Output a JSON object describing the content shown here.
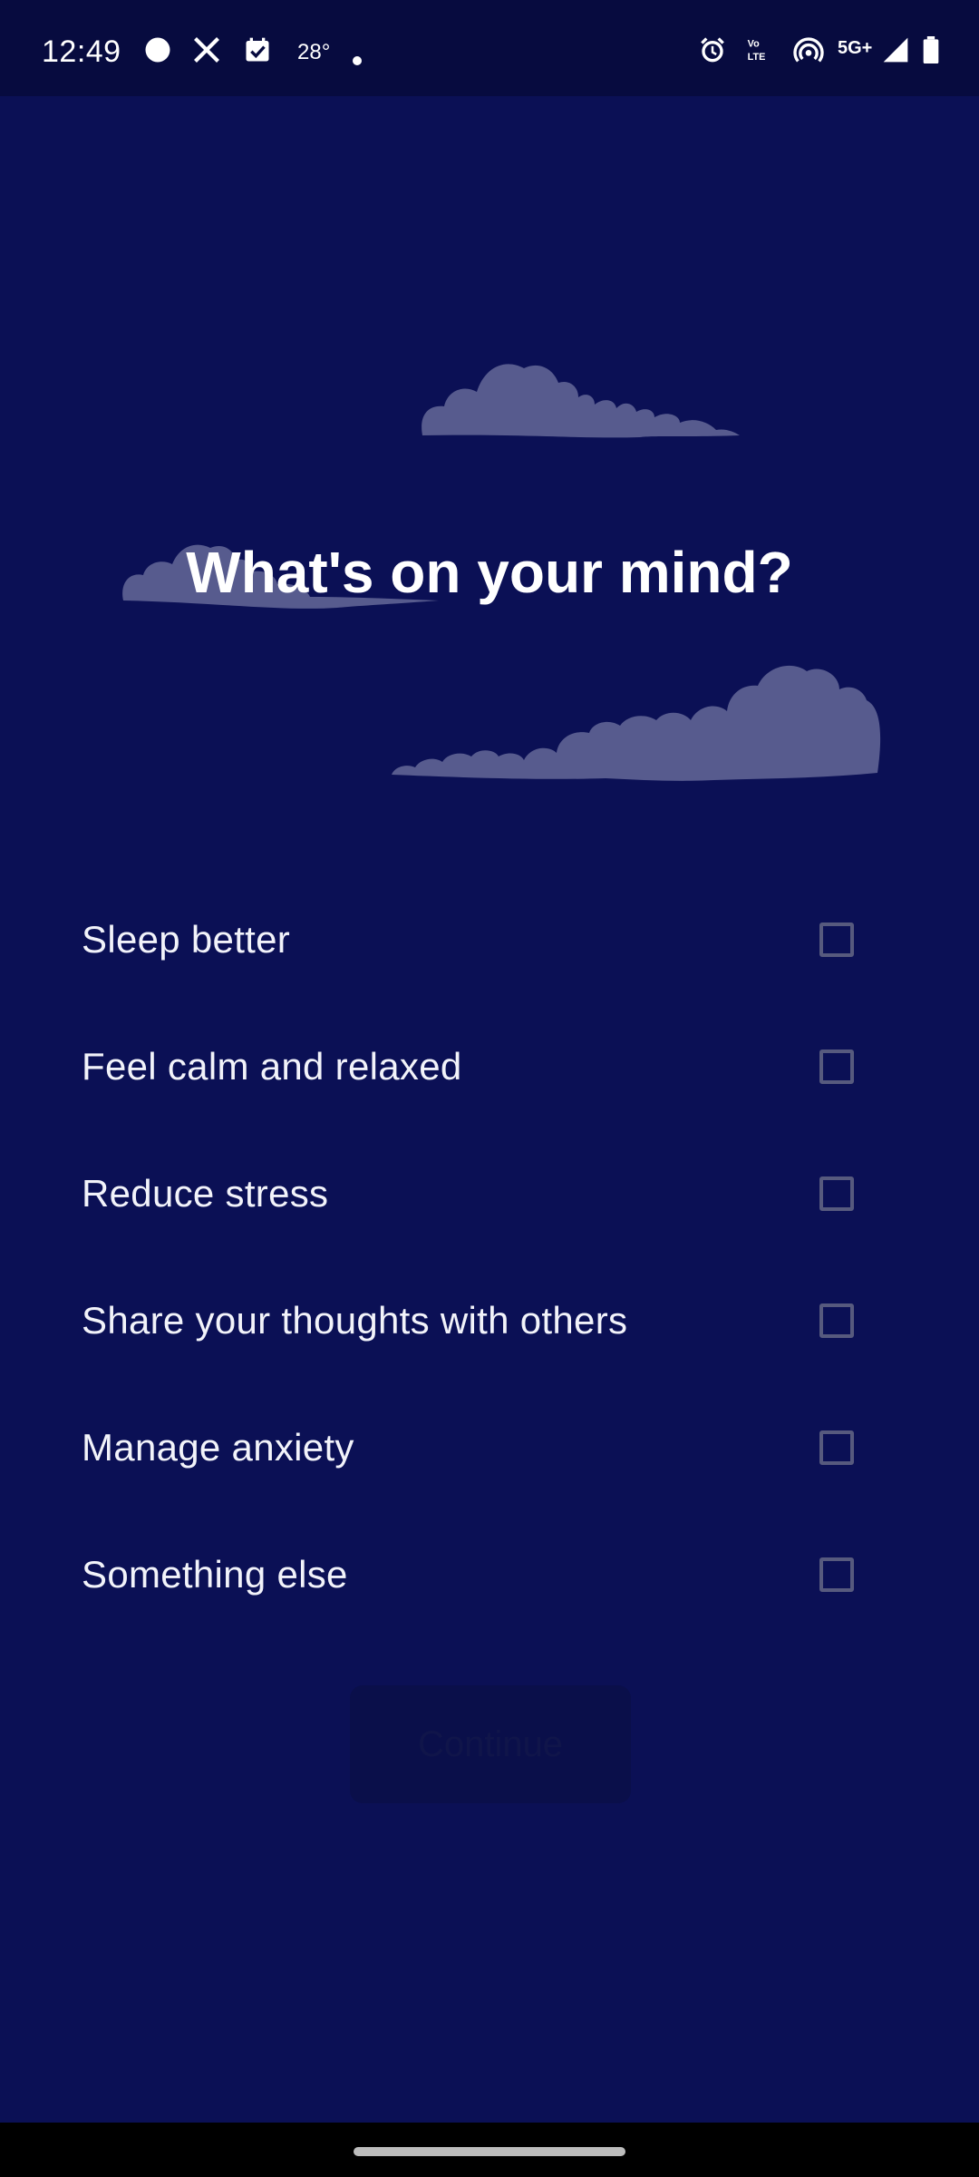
{
  "status_bar": {
    "time": "12:49",
    "temperature": "28°",
    "left_icons": [
      "circle-app-icon",
      "x-app-icon",
      "calendar-icon",
      "dot-icon"
    ],
    "right_icons": [
      "alarm-icon",
      "volte-icon",
      "hotspot-icon",
      "5g-signal-icon",
      "signal-icon",
      "battery-icon"
    ],
    "network_label": "5G+",
    "volte_label": "Vo LTE"
  },
  "screen": {
    "title": "What's on your mind?",
    "options": [
      {
        "label": "Sleep better",
        "checked": false
      },
      {
        "label": "Feel calm and relaxed",
        "checked": false
      },
      {
        "label": "Reduce stress",
        "checked": false
      },
      {
        "label": "Share your thoughts with others",
        "checked": false
      },
      {
        "label": "Manage anxiety",
        "checked": false
      },
      {
        "label": "Something else",
        "checked": false
      }
    ],
    "continue_label": "Continue",
    "continue_enabled": false
  },
  "colors": {
    "background": "#0b1055",
    "status_bar": "#070b3f",
    "cloud": "#575b8e",
    "text": "#ffffff",
    "checkbox_border": "#575a7e"
  }
}
